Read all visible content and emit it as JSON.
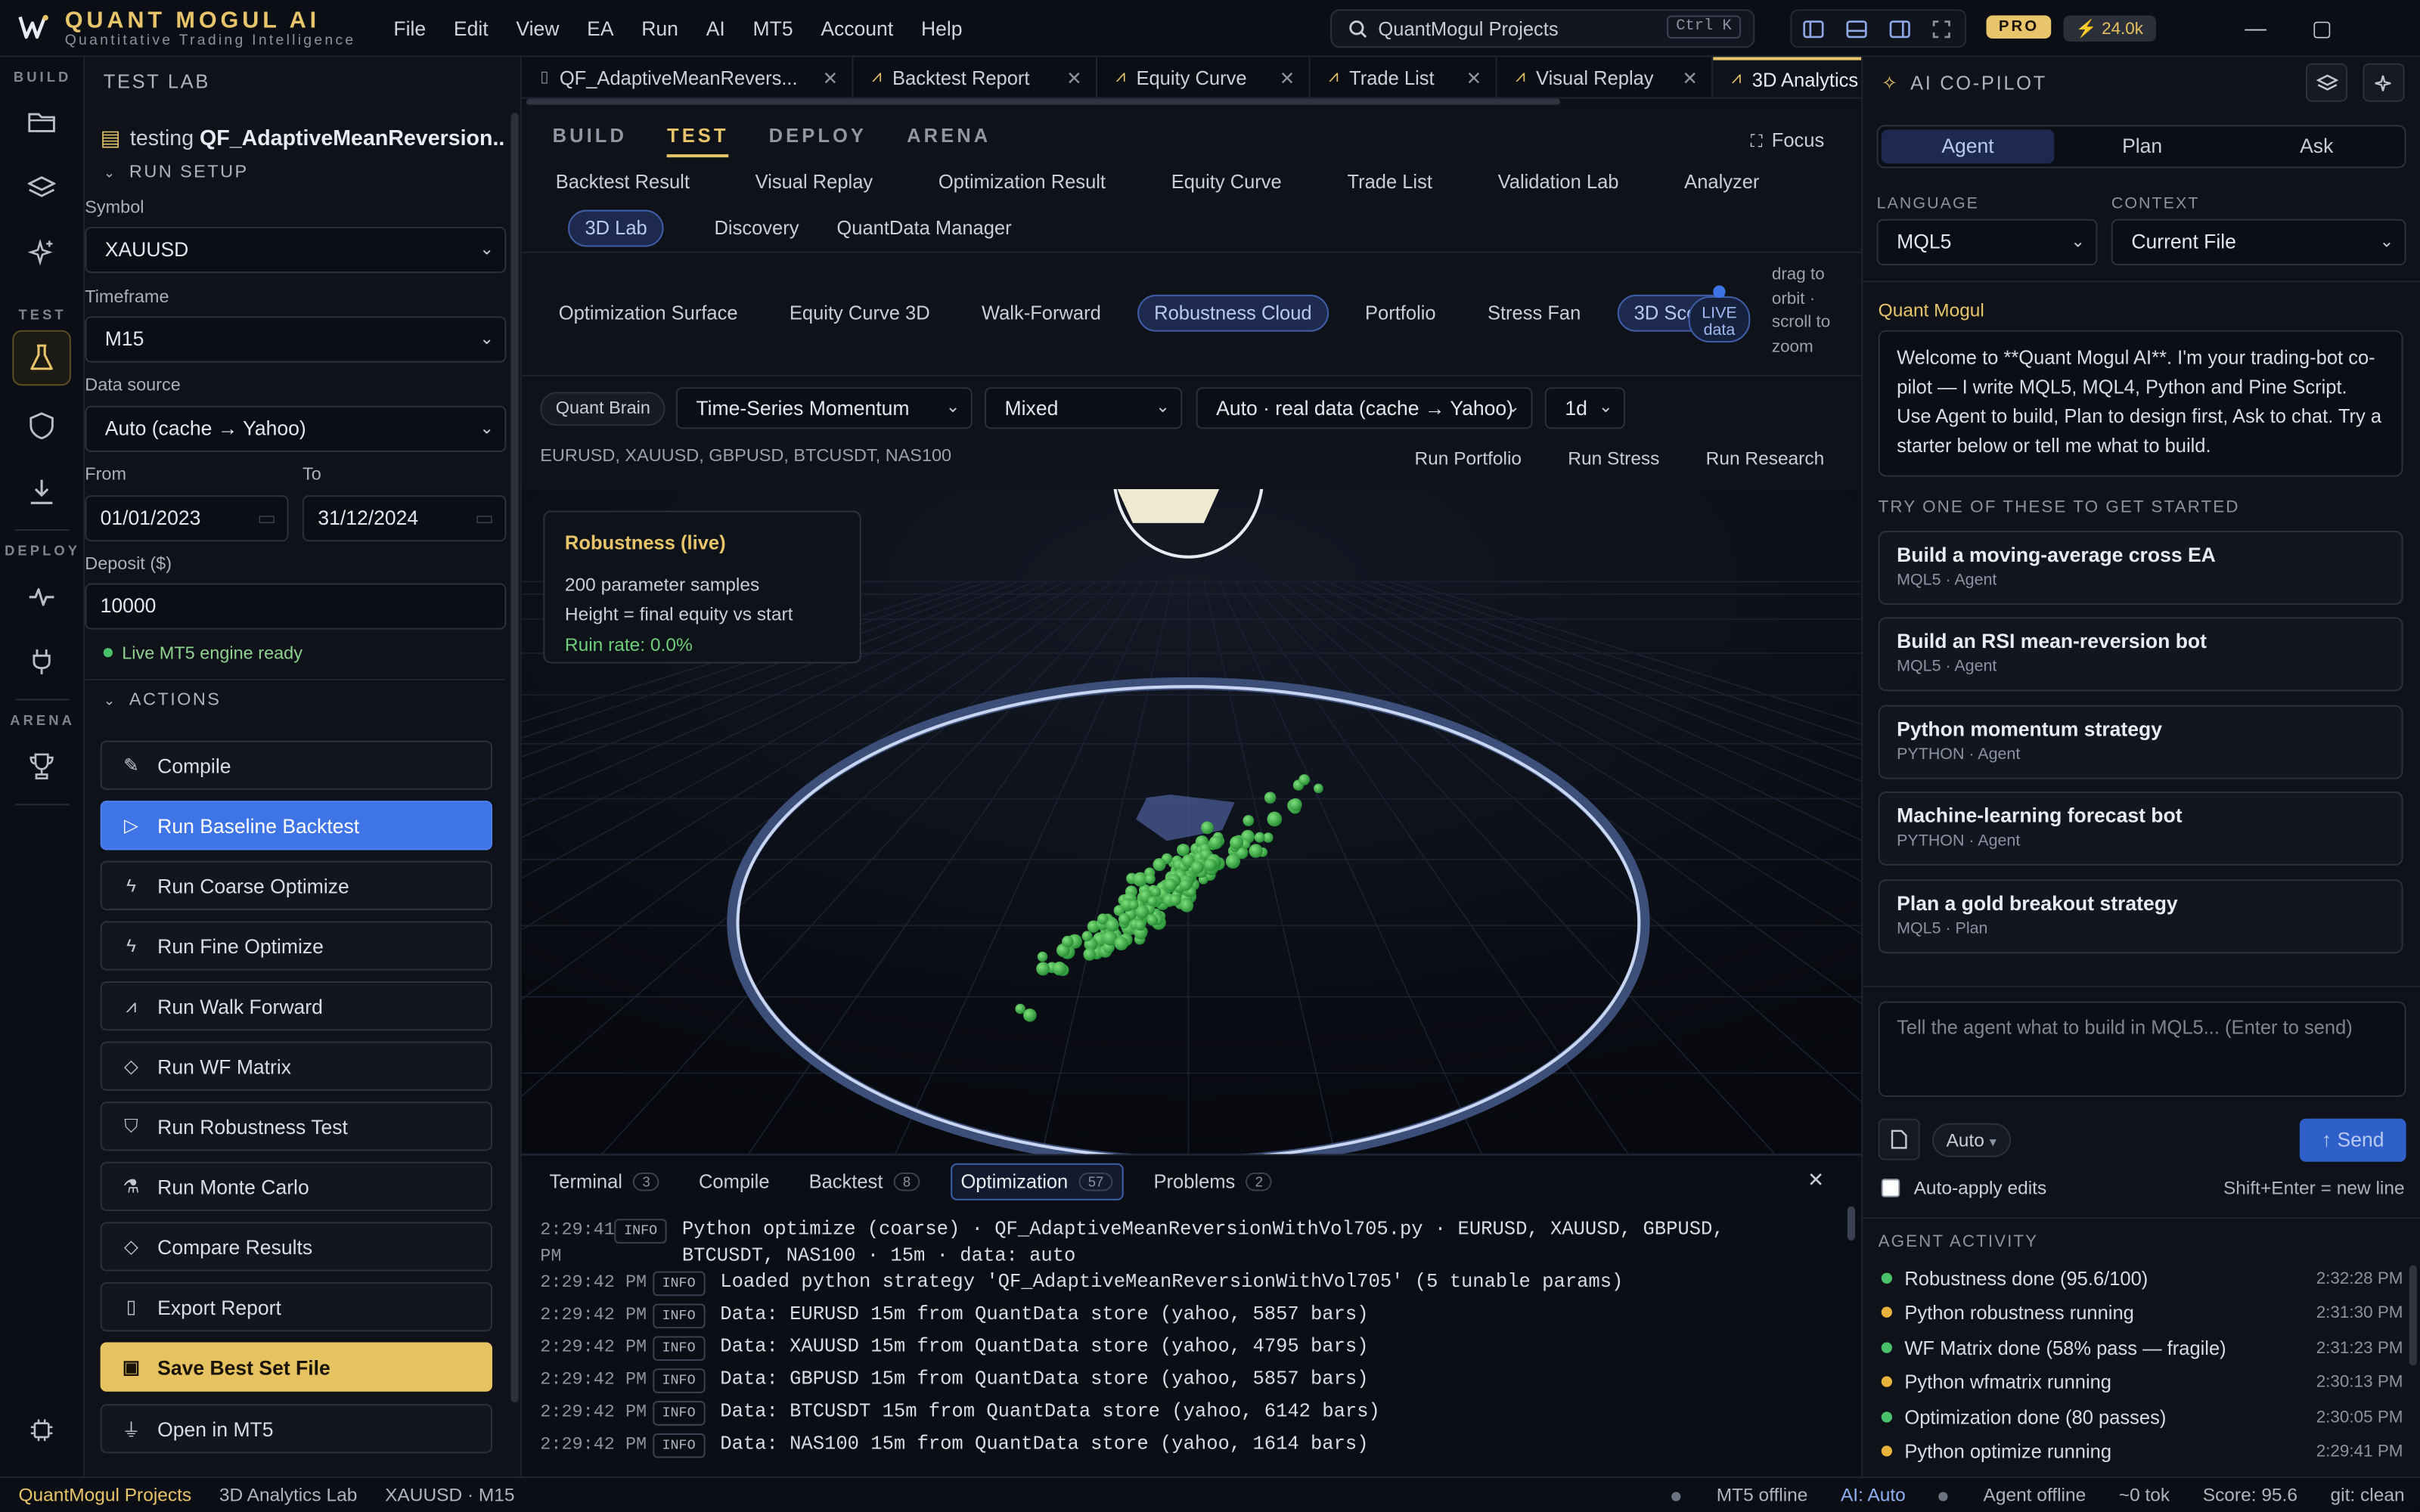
{
  "app": {
    "brand_name": "QUANT MOGUL AI",
    "brand_tagline": "Quantitative Trading Intelligence"
  },
  "menu": [
    "File",
    "Edit",
    "View",
    "EA",
    "Run",
    "AI",
    "MT5",
    "Account",
    "Help"
  ],
  "search": {
    "placeholder": "QuantMogul Projects",
    "shortcut": "Ctrl K"
  },
  "plan_badge": "PRO",
  "credits": "24.0k",
  "activity": {
    "build_label": "BUILD",
    "test_label": "TEST",
    "deploy_label": "DEPLOY",
    "arena_label": "ARENA"
  },
  "sidebar": {
    "title": "TEST LAB",
    "file_prefix": "testing ",
    "file_name": "QF_AdaptiveMeanReversion...",
    "run_setup": "RUN SETUP",
    "symbol_label": "Symbol",
    "symbol_value": "XAUUSD",
    "timeframe_label": "Timeframe",
    "timeframe_value": "M15",
    "source_label": "Data source",
    "source_value": "Auto (cache → Yahoo)",
    "from_label": "From",
    "from_value": "01/01/2023",
    "to_label": "To",
    "to_value": "31/12/2024",
    "deposit_label": "Deposit ($)",
    "deposit_value": "10000",
    "engine_status": "Live MT5 engine ready",
    "actions_label": "ACTIONS",
    "actions": [
      "Compile",
      "Run Baseline Backtest",
      "Run Coarse Optimize",
      "Run Fine Optimize",
      "Run Walk Forward",
      "Run WF Matrix",
      "Run Robustness Test",
      "Run Monte Carlo",
      "Compare Results",
      "Export Report",
      "Save Best Set File",
      "Open in MT5"
    ]
  },
  "tabs": [
    {
      "label": "QF_AdaptiveMeanRevers...",
      "icon": "file-icon"
    },
    {
      "label": "Backtest Report",
      "icon": "chart-icon"
    },
    {
      "label": "Equity Curve",
      "icon": "chart-icon"
    },
    {
      "label": "Trade List",
      "icon": "chart-icon"
    },
    {
      "label": "Visual Replay",
      "icon": "chart-icon"
    },
    {
      "label": "3D Analytics",
      "icon": "chart-icon"
    }
  ],
  "modes": [
    "BUILD",
    "TEST",
    "DEPLOY",
    "ARENA"
  ],
  "focus_label": "Focus",
  "subtabs": [
    "Backtest Result",
    "Visual Replay",
    "Optimization Result",
    "Equity Curve",
    "Trade List",
    "Validation Lab",
    "Analyzer",
    "3D Lab",
    "Discovery",
    "QuantData Manager"
  ],
  "lab_tabs": [
    "Optimization Surface",
    "Equity Curve 3D",
    "Walk-Forward",
    "Robustness Cloud",
    "Portfolio",
    "Stress Fan",
    "3D Scene"
  ],
  "live": {
    "line1": "LIVE",
    "line2": "data"
  },
  "orbit_note": "drag to orbit · scroll to zoom",
  "research": {
    "brain": "Quant Brain",
    "strategy": "Time-Series Momentum",
    "mode": "Mixed",
    "source": "Auto · real data (cache → Yahoo)",
    "interval": "1d",
    "symbols": "EURUSD, XAUUSD, GBPUSD, BTCUSDT, NAS100",
    "run_portfolio": "Run Portfolio",
    "run_stress": "Run Stress",
    "run_research": "Run Research"
  },
  "robustness": {
    "title": "Robustness (live)",
    "samples": "200 parameter samples",
    "height_note": "Height = final equity vs start",
    "ruin": "Ruin rate: 0.0%"
  },
  "console": {
    "tabs": [
      {
        "label": "Terminal",
        "count": "3"
      },
      {
        "label": "Compile",
        "count": ""
      },
      {
        "label": "Backtest",
        "count": "8"
      },
      {
        "label": "Optimization",
        "count": "57"
      },
      {
        "label": "Problems",
        "count": "2"
      }
    ],
    "logs": [
      {
        "time": "2:29:41 PM",
        "level": "INFO",
        "msg": "Python optimize (coarse) · QF_AdaptiveMeanReversionWithVol705.py · EURUSD, XAUUSD, GBPUSD, BTCUSDT, NAS100 · 15m · data: auto"
      },
      {
        "time": "2:29:42 PM",
        "level": "INFO",
        "msg": "Loaded python strategy 'QF_AdaptiveMeanReversionWithVol705' (5 tunable params)"
      },
      {
        "time": "2:29:42 PM",
        "level": "INFO",
        "msg": "Data: EURUSD 15m from QuantData store (yahoo, 5857 bars)"
      },
      {
        "time": "2:29:42 PM",
        "level": "INFO",
        "msg": "Data: XAUUSD 15m from QuantData store (yahoo, 4795 bars)"
      },
      {
        "time": "2:29:42 PM",
        "level": "INFO",
        "msg": "Data: GBPUSD 15m from QuantData store (yahoo, 5857 bars)"
      },
      {
        "time": "2:29:42 PM",
        "level": "INFO",
        "msg": "Data: BTCUSDT 15m from QuantData store (yahoo, 6142 bars)"
      },
      {
        "time": "2:29:42 PM",
        "level": "INFO",
        "msg": "Data: NAS100 15m from QuantData store (yahoo, 1614 bars)"
      }
    ]
  },
  "copilot": {
    "title": "AI CO-PILOT",
    "modes": [
      "Agent",
      "Plan",
      "Ask"
    ],
    "language_label": "LANGUAGE",
    "language_value": "MQL5",
    "context_label": "CONTEXT",
    "context_value": "Current File",
    "name": "Quant Mogul",
    "welcome": "Welcome to **Quant Mogul AI**. I'm your trading-bot co-pilot — I write MQL5, MQL4, Python and Pine Script. Use Agent to build, Plan to design first, Ask to chat. Try a starter below or tell me what to build.",
    "starters_label": "TRY ONE OF THESE TO GET STARTED",
    "starters": [
      {
        "title": "Build a moving-average cross EA",
        "sub": "MQL5 · Agent"
      },
      {
        "title": "Build an RSI mean-reversion bot",
        "sub": "MQL5 · Agent"
      },
      {
        "title": "Python momentum strategy",
        "sub": "PYTHON · Agent"
      },
      {
        "title": "Machine-learning forecast bot",
        "sub": "PYTHON · Agent"
      },
      {
        "title": "Plan a gold breakout strategy",
        "sub": "MQL5 · Plan"
      }
    ],
    "prompt_placeholder": "Tell the agent what to build in MQL5...  (Enter to send)",
    "auto_label": "Auto",
    "send_label": "Send",
    "auto_apply": "Auto-apply edits",
    "shift_hint": "Shift+Enter = new line",
    "activity_label": "AGENT ACTIVITY",
    "activity": [
      {
        "text": "Robustness done (95.6/100)",
        "time": "2:32:28 PM",
        "color": "#4bc06a"
      },
      {
        "text": "Python robustness running",
        "time": "2:31:30 PM",
        "color": "#e8b33c"
      },
      {
        "text": "WF Matrix done (58% pass — fragile)",
        "time": "2:31:23 PM",
        "color": "#4bc06a"
      },
      {
        "text": "Python wfmatrix running",
        "time": "2:30:13 PM",
        "color": "#e8b33c"
      },
      {
        "text": "Optimization done (80 passes)",
        "time": "2:30:05 PM",
        "color": "#4bc06a"
      },
      {
        "text": "Python optimize running",
        "time": "2:29:41 PM",
        "color": "#e8b33c"
      }
    ]
  },
  "statusbar": {
    "project": "QuantMogul Projects",
    "lab": "3D Analytics Lab",
    "symbol_tf": "XAUUSD · M15",
    "mt5": "MT5 offline",
    "ai": "AI: Auto",
    "agent": "Agent offline",
    "tokens": "~0 tok",
    "score": "Score: 95.6",
    "git": "git: clean"
  },
  "colors": {
    "accent_gold": "#e8c46a",
    "accent_blue": "#3f74e6",
    "success": "#4bc06a",
    "warning": "#e8b33c"
  }
}
